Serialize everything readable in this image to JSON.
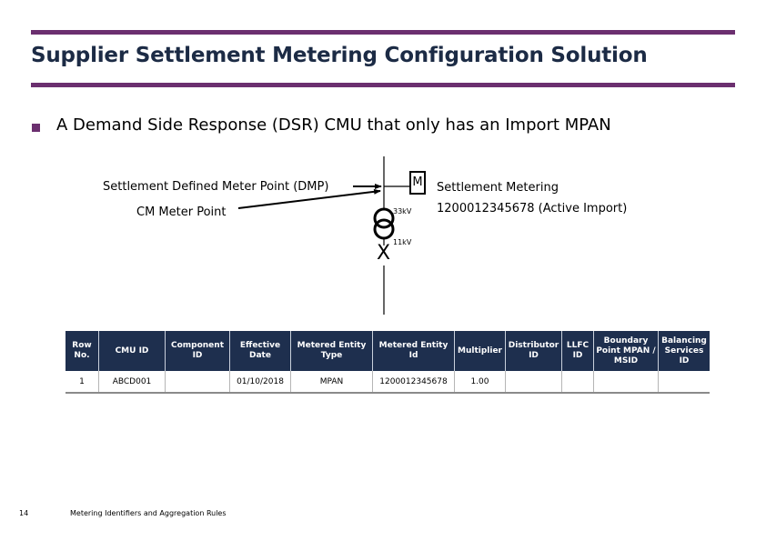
{
  "slide": {
    "title": "Supplier Settlement Metering Configuration Solution",
    "bullet": "A Demand Side Response (DSR) CMU that only has an Import MPAN",
    "accent_color": "#6b2f6f",
    "title_color": "#1c2b45"
  },
  "diagram": {
    "dmp_label": "Settlement Defined Meter Point (DMP)",
    "cm_label": "CM Meter Point",
    "meter_symbol": "M",
    "hv_label": "33kV",
    "lv_label": "11kV",
    "breaker_symbol": "X",
    "settlement_metering_title": "Settlement Metering",
    "settlement_metering_value": "1200012345678 (Active Import)"
  },
  "table": {
    "header_color": "#1e2f4e",
    "columns": [
      "Row No.",
      "CMU ID",
      "Component ID",
      "Effective Date",
      "Metered Entity Type",
      "Metered Entity Id",
      "Multiplier",
      "Distributor ID",
      "LLFC ID",
      "Boundary Point MPAN / MSID",
      "Balancing Services ID"
    ],
    "rows": [
      [
        "1",
        "ABCD001",
        "",
        "01/10/2018",
        "MPAN",
        "1200012345678",
        "1.00",
        "",
        "",
        "",
        ""
      ]
    ]
  },
  "footer": {
    "page_number": "14",
    "text": "Metering Identifiers and Aggregation Rules"
  }
}
